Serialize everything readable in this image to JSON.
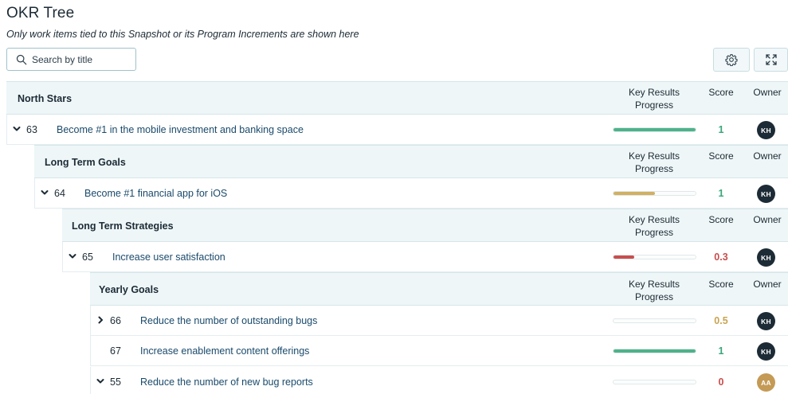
{
  "page": {
    "title": "OKR Tree",
    "subtitle": "Only work items tied to this Snapshot or its Program Increments are shown here"
  },
  "search": {
    "placeholder": "Search by title",
    "icon": "search-icon"
  },
  "toolbar": {
    "settings_icon": "gear-icon",
    "expand_icon": "expand-icon"
  },
  "columns": {
    "key_results_line1": "Key Results",
    "key_results_line2": "Progress",
    "score": "Score",
    "owner": "Owner"
  },
  "levels": [
    {
      "label": "North Stars"
    },
    {
      "label": "Long Term Goals"
    },
    {
      "label": "Long Term Strategies"
    },
    {
      "label": "Yearly Goals"
    }
  ],
  "rows": [
    {
      "id": "63",
      "title": "Become #1 in the mobile investment and banking space",
      "chevron": "chevron-down-icon",
      "progress": 1.0,
      "progress_color": "#4db38a",
      "score": "1",
      "score_color": "#3aa67a",
      "owner": "KH",
      "owner_color": "#1c2b36"
    },
    {
      "id": "64",
      "title": "Become #1 financial app for iOS",
      "chevron": "chevron-down-icon",
      "progress": 0.5,
      "progress_color": "#d1b062",
      "score": "1",
      "score_color": "#3aa67a",
      "owner": "KH",
      "owner_color": "#1c2b36"
    },
    {
      "id": "65",
      "title": "Increase user satisfaction",
      "chevron": "chevron-down-icon",
      "progress": 0.25,
      "progress_color": "#c94d4d",
      "score": "0.3",
      "score_color": "#c94d4d",
      "owner": "KH",
      "owner_color": "#1c2b36"
    },
    {
      "id": "66",
      "title": "Reduce the number of outstanding bugs",
      "chevron": "chevron-right-icon",
      "progress": 0.0,
      "progress_color": "#4db38a",
      "score": "0.5",
      "score_color": "#c9a450",
      "owner": "KH",
      "owner_color": "#1c2b36"
    },
    {
      "id": "67",
      "title": "Increase enablement content offerings",
      "chevron": "",
      "progress": 1.0,
      "progress_color": "#4db38a",
      "score": "1",
      "score_color": "#3aa67a",
      "owner": "KH",
      "owner_color": "#1c2b36"
    },
    {
      "id": "55",
      "title": "Reduce the number of new bug reports",
      "chevron": "chevron-down-icon",
      "progress": 0.0,
      "progress_color": "#4db38a",
      "score": "0",
      "score_color": "#c94d4d",
      "owner": "AA",
      "owner_color": "#c49a55"
    }
  ]
}
